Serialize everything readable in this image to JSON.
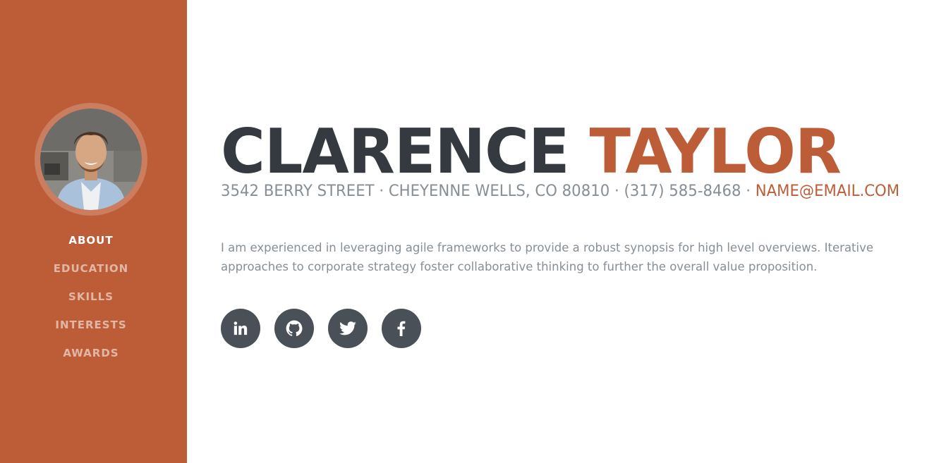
{
  "profile": {
    "first_name": "CLARENCE",
    "last_name": "TAYLOR",
    "address_phone": "3542 BERRY STREET · CHEYENNE WELLS, CO 80810 · (317) 585-8468 · ",
    "email": "NAME@EMAIL.COM",
    "bio": "I am experienced in leveraging agile frameworks to provide a robust synopsis for high level overviews. Iterative approaches to corporate strategy foster collaborative thinking to further the overall value proposition."
  },
  "sidebar": {
    "items": [
      {
        "label": "ABOUT",
        "active": true
      },
      {
        "label": "EDUCATION",
        "active": false
      },
      {
        "label": "SKILLS",
        "active": false
      },
      {
        "label": "INTERESTS",
        "active": false
      },
      {
        "label": "AWARDS",
        "active": false
      }
    ]
  },
  "social": [
    {
      "icon": "linkedin-icon"
    },
    {
      "icon": "github-icon"
    },
    {
      "icon": "twitter-icon"
    },
    {
      "icon": "facebook-icon"
    }
  ],
  "colors": {
    "accent": "#bd5d38",
    "dark": "#343a40",
    "muted": "#868e96",
    "social_bg": "#495057"
  }
}
